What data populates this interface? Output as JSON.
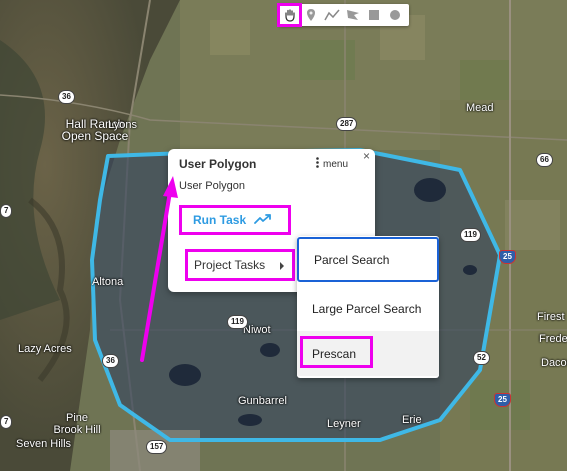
{
  "map": {
    "place_labels": [
      {
        "text": "Hall Ranch\nOpen Space",
        "key": "hall"
      },
      {
        "text": "Lyons",
        "key": "lyons"
      },
      {
        "text": "Mead",
        "key": "mead"
      },
      {
        "text": "Altona",
        "key": "altona"
      },
      {
        "text": "Lazy Acres",
        "key": "lazy"
      },
      {
        "text": "Niwot",
        "key": "niwot"
      },
      {
        "text": "Gunbarrel",
        "key": "gunbarrel"
      },
      {
        "text": "Pine\nBrook Hill",
        "key": "pine"
      },
      {
        "text": "Seven Hills",
        "key": "seven"
      },
      {
        "text": "Leyner",
        "key": "leyner"
      },
      {
        "text": "Erie",
        "key": "erie"
      },
      {
        "text": "Firest",
        "key": "firest"
      },
      {
        "text": "Frede",
        "key": "frede"
      },
      {
        "text": "Dacon",
        "key": "dacon"
      }
    ],
    "road_shields": [
      "36",
      "287",
      "66",
      "119",
      "25",
      "36",
      "119",
      "52",
      "25",
      "157",
      "7",
      "7"
    ]
  },
  "toolbar": {
    "tools": [
      {
        "icon": "hand-icon",
        "title": "pan"
      },
      {
        "icon": "marker-icon",
        "title": "marker"
      },
      {
        "icon": "polyline-icon",
        "title": "line"
      },
      {
        "icon": "polygon-icon",
        "title": "polygon"
      },
      {
        "icon": "rectangle-icon",
        "title": "rectangle"
      },
      {
        "icon": "circle-icon",
        "title": "circle"
      }
    ]
  },
  "infowindow": {
    "title": "User Polygon",
    "menu_label": "menu",
    "close_glyph": "×",
    "subtitle": "User Polygon",
    "run_task_label": "Run Task",
    "project_tasks_label": "Project Tasks"
  },
  "submenu": {
    "items": [
      "Parcel Search",
      "Large Parcel Search",
      "Prescan"
    ]
  },
  "colors": {
    "highlight": "#ee00ee",
    "polygon_stroke": "#3fb8e6",
    "link_blue": "#2e9be2",
    "focus_blue": "#1a62d6"
  }
}
